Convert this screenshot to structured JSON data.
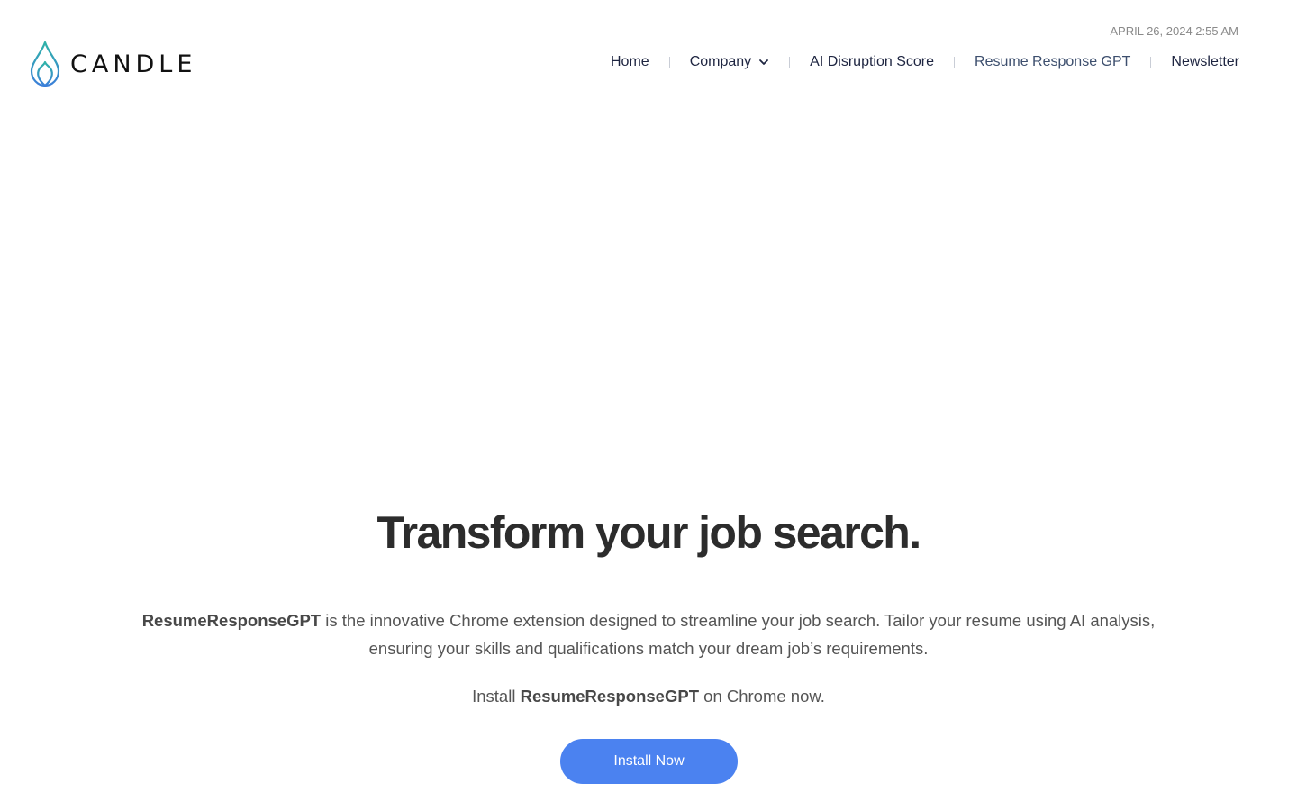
{
  "header": {
    "logo_text": "CANDLE",
    "datetime": "APRIL 26, 2024 2:55 AM",
    "nav": [
      {
        "label": "Home"
      },
      {
        "label": "Company"
      },
      {
        "label": "AI Disruption Score"
      },
      {
        "label": "Resume Response GPT",
        "active": true
      },
      {
        "label": "Newsletter"
      }
    ]
  },
  "hero": {
    "title": "Transform your job search.",
    "description_strong": "ResumeResponseGPT",
    "description_rest": " is the innovative Chrome extension designed to streamline your job search. Tailor your resume using AI analysis, ensuring your skills and qualifications match your dream job’s requirements.",
    "install_prefix": "Install ",
    "install_strong": "ResumeResponseGPT",
    "install_suffix": " on Chrome now.",
    "button_label": "Install Now"
  },
  "colors": {
    "accent": "#4b82f0",
    "nav_text": "#1e2541",
    "heading": "#2c2c2c",
    "body_text": "#555555",
    "logo_teal": "#2fb3a8",
    "logo_blue": "#3b7fd9"
  },
  "icons": {
    "logo": "candle-flame-icon",
    "company_dropdown": "chevron-down-icon"
  }
}
